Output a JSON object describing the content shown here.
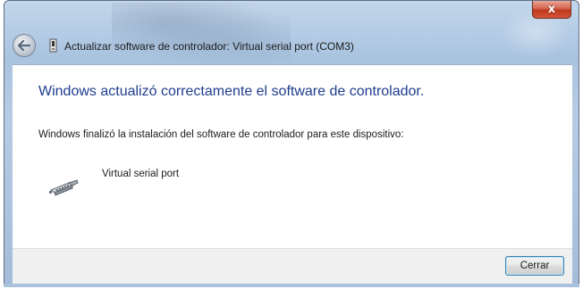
{
  "window": {
    "title": "Actualizar software de controlador: Virtual serial port (COM3)",
    "close_glyph": "x"
  },
  "nav": {
    "back_icon": "back-arrow-icon"
  },
  "content": {
    "heading": "Windows actualizó correctamente el software de controlador.",
    "description": "Windows finalizó la instalación del software de controlador para este dispositivo:",
    "device_name": "Virtual serial port",
    "device_icon": "serial-port-icon"
  },
  "footer": {
    "close_label": "Cerrar"
  },
  "colors": {
    "heading": "#1f3d8c",
    "close_button_red": "#c0381b",
    "glass_frame": "#b6cde6"
  }
}
